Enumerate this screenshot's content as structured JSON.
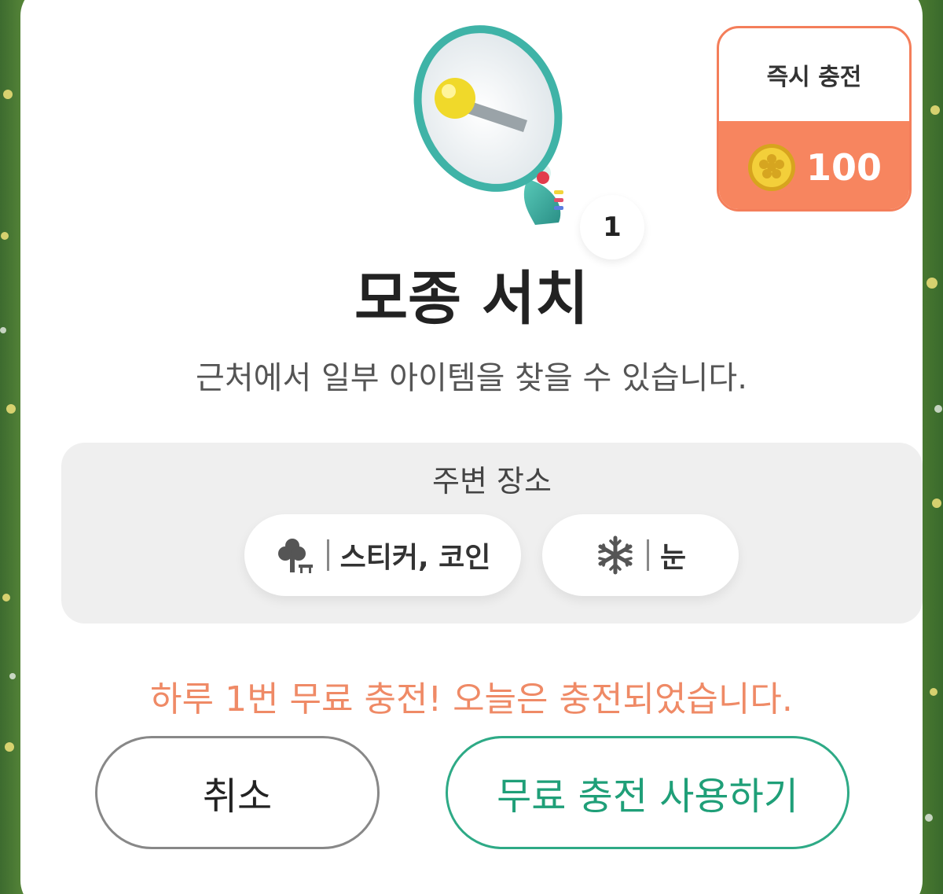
{
  "item": {
    "name": "모종 서치",
    "description": "근처에서 일부 아이템을 찾을 수 있습니다.",
    "count": "1",
    "icon": "megaphone-icon"
  },
  "instant_charge": {
    "title": "즉시 충전",
    "price": "100",
    "currency_icon": "coin-icon"
  },
  "nearby": {
    "title": "주변 장소",
    "places": [
      {
        "icon": "tree-park-icon",
        "label": "스티커, 코인"
      },
      {
        "icon": "snowflake-icon",
        "label": "눈"
      }
    ]
  },
  "notice": "하루 1번 무료 충전! 오늘은 충전되었습니다.",
  "buttons": {
    "cancel": "취소",
    "use_free": "무료 충전 사용하기"
  },
  "colors": {
    "accent_orange": "#f7855f",
    "accent_green": "#2eaa86",
    "notice": "#ef8a66"
  }
}
